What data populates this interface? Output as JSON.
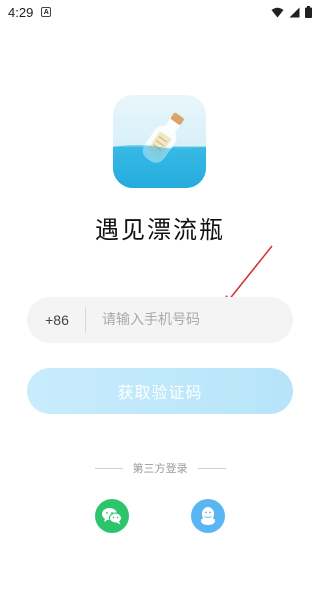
{
  "status_bar": {
    "time": "4:29",
    "notification_icon": "A"
  },
  "app": {
    "title": "遇见漂流瓶",
    "icon": "message-bottle-icon"
  },
  "login": {
    "country_code": "+86",
    "phone_placeholder": "请输入手机号码",
    "phone_value": "",
    "get_code_label": "获取验证码"
  },
  "third_party": {
    "label": "第三方登录",
    "providers": [
      "wechat",
      "qq"
    ]
  },
  "colors": {
    "button_bg": "#c0e8fb",
    "wechat": "#2cc56b",
    "qq": "#5ab6f3",
    "arrow": "#d32f2f"
  }
}
